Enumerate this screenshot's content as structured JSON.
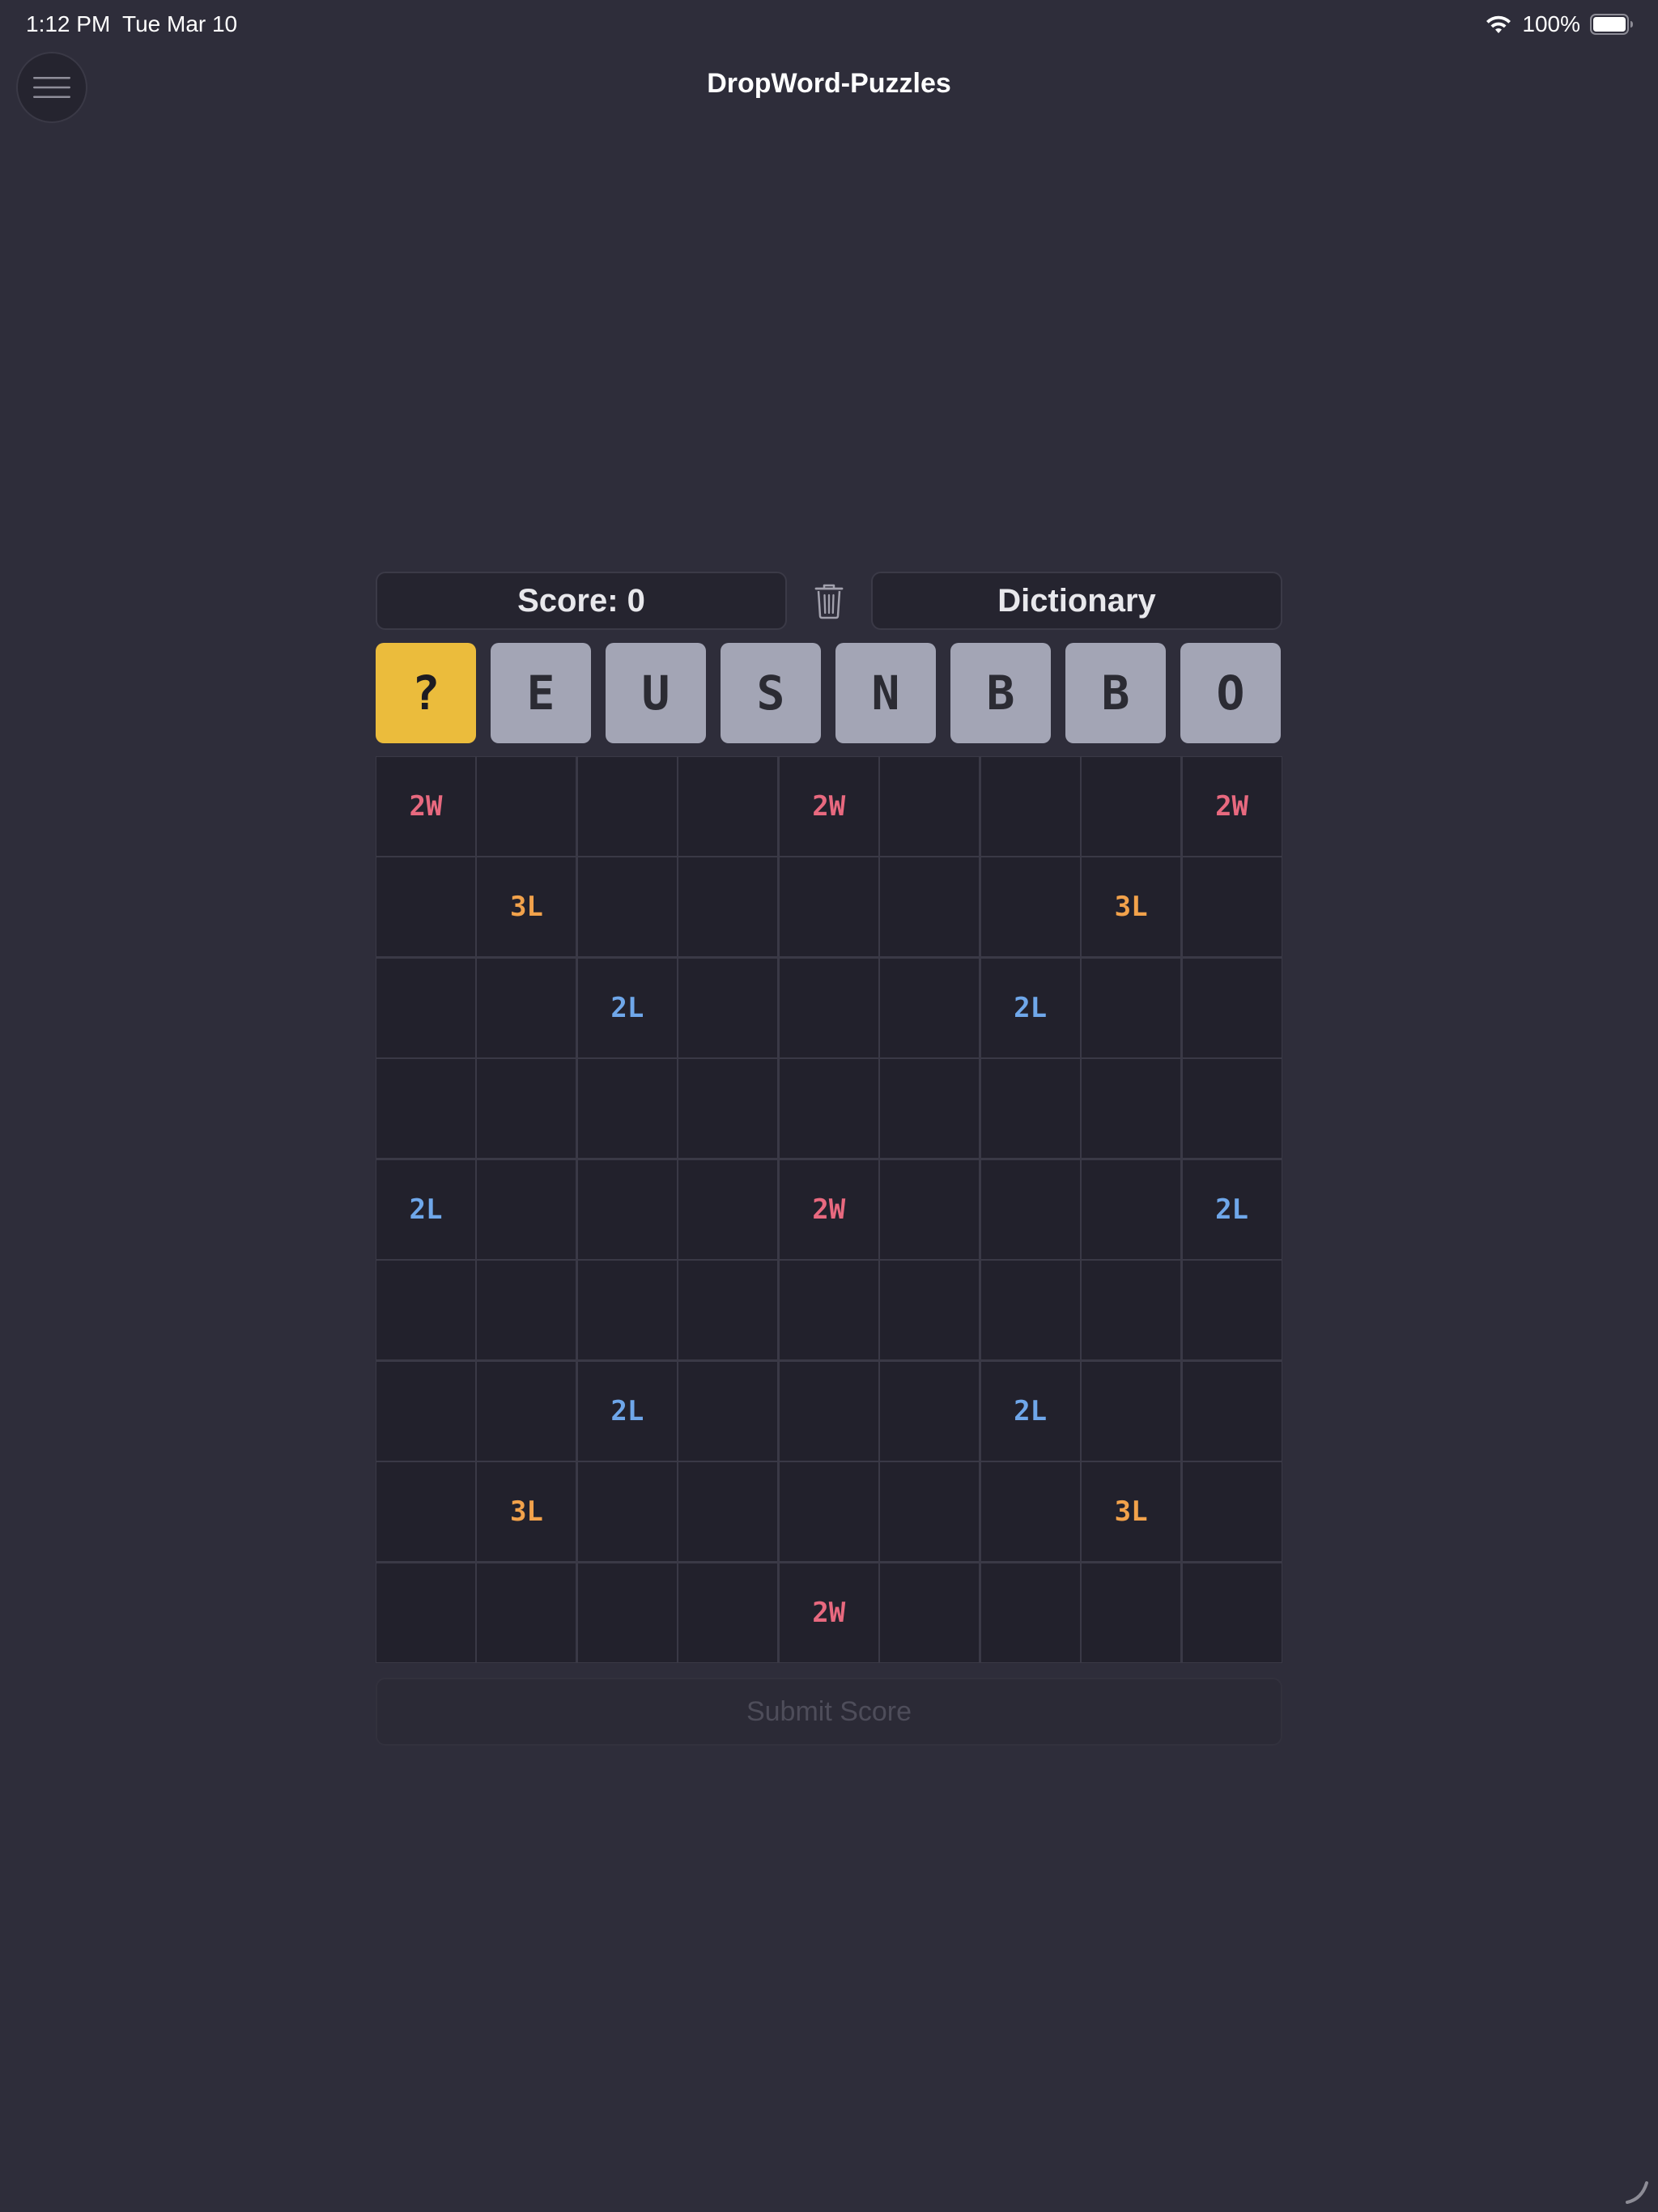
{
  "status_bar": {
    "time": "1:12 PM",
    "date": "Tue Mar 10",
    "battery_percent": "100%",
    "battery_level": 1.0,
    "icons": [
      "wifi-icon",
      "battery-icon"
    ]
  },
  "header": {
    "title": "DropWord-Puzzles",
    "menu_icon": "hamburger-menu-icon"
  },
  "score": {
    "label": "Score: 0"
  },
  "trash": {
    "icon": "trash-icon"
  },
  "dictionary": {
    "label": "Dictionary"
  },
  "rack": {
    "tiles": [
      "?",
      "E",
      "U",
      "S",
      "N",
      "B",
      "B",
      "O"
    ]
  },
  "board": {
    "size": 9,
    "cells": [
      [
        "2W",
        "",
        "",
        "",
        "2W",
        "",
        "",
        "",
        "2W"
      ],
      [
        "",
        "3L",
        "",
        "",
        "",
        "",
        "",
        "3L",
        ""
      ],
      [
        "",
        "",
        "2L",
        "",
        "",
        "",
        "2L",
        "",
        ""
      ],
      [
        "",
        "",
        "",
        "",
        "",
        "",
        "",
        "",
        ""
      ],
      [
        "2L",
        "",
        "",
        "",
        "2W",
        "",
        "",
        "",
        "2L"
      ],
      [
        "",
        "",
        "",
        "",
        "",
        "",
        "",
        "",
        ""
      ],
      [
        "",
        "",
        "2L",
        "",
        "",
        "",
        "2L",
        "",
        ""
      ],
      [
        "",
        "3L",
        "",
        "",
        "",
        "",
        "",
        "3L",
        ""
      ],
      [
        "",
        "",
        "",
        "",
        "2W",
        "",
        "",
        "",
        ""
      ]
    ],
    "bonus_colors": {
      "2W": "#e8697f",
      "3L": "#f2a24b",
      "2L": "#6fa7ea"
    }
  },
  "submit": {
    "label": "Submit Score",
    "enabled": false
  },
  "colors": {
    "background": "#2e2d3a",
    "blank_tile": "#ebbc3c",
    "letter_tile": "#a3a5b5",
    "cell": "#22212c"
  }
}
